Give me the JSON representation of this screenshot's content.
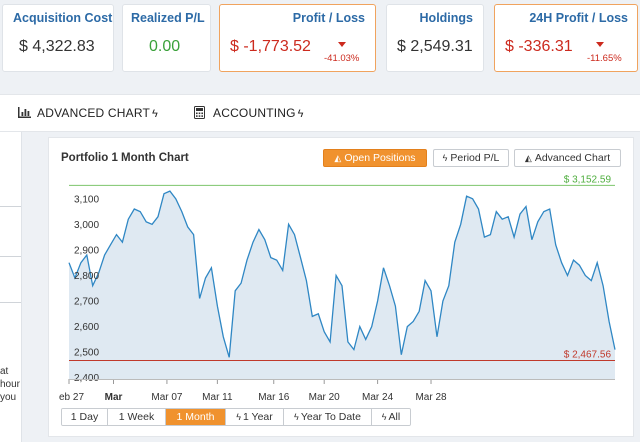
{
  "cards": [
    {
      "title": "Acquisition Cost",
      "value": "$ 4,322.83",
      "tone": "normal",
      "change": null
    },
    {
      "title": "Realized P/L",
      "value": "0.00",
      "tone": "green",
      "change": null
    },
    {
      "title": "Profit / Loss",
      "value": "$ -1,773.52",
      "tone": "red",
      "change": "-41.03%"
    },
    {
      "title": "Holdings",
      "value": "$ 2,549.31",
      "tone": "normal",
      "change": null
    },
    {
      "title": "24H Profit / Loss",
      "value": "$ -336.31",
      "tone": "red",
      "change": "-11.65%"
    }
  ],
  "toolbar": {
    "advanced_chart": "ADVANCED CHART",
    "accounting": "ACCOUNTING"
  },
  "sidebar": {
    "text_1": "at",
    "text_2": "hour",
    "text_3": "you"
  },
  "chart_panel": {
    "title": "Portfolio 1 Month Chart",
    "buttons": {
      "open_positions": "Open Positions",
      "period_pl": "Period P/L",
      "advanced_chart": "Advanced Chart"
    },
    "ranges": [
      "1 Day",
      "1 Week",
      "1 Month",
      "1 Year",
      "Year To Date",
      "All"
    ],
    "active_range": "1 Month"
  },
  "colors": {
    "accent_orange": "#f0922e",
    "title_blue": "#2c6aa6",
    "profit_green": "#3aa13a",
    "loss_red": "#cc2a1e",
    "line_blue": "#2f87c4",
    "area_fill": "#dfe9f2"
  },
  "chart_data": {
    "type": "area",
    "title": "Portfolio 1 Month Chart",
    "x_ticks": [
      "eb 27",
      "Mar",
      "Mar 07",
      "Mar 11",
      "Mar 16",
      "Mar 20",
      "Mar 24",
      "Mar 28"
    ],
    "x_tick_indices": [
      0,
      7.5,
      16.5,
      25,
      34.5,
      43,
      52,
      61
    ],
    "y_ticks": [
      2400,
      2500,
      2600,
      2700,
      2800,
      2900,
      3000,
      3100
    ],
    "ylim": [
      2395,
      3150
    ],
    "high_label": "$ 3,152.59",
    "high_value": 3152.59,
    "low_label": "$ 2,467.56",
    "low_value": 2467.56,
    "grid": false,
    "series": [
      {
        "values": [
          2850,
          2790,
          2850,
          2880,
          2760,
          2810,
          2880,
          2920,
          2960,
          2930,
          3020,
          3060,
          3050,
          3010,
          3000,
          3030,
          3120,
          3130,
          3100,
          3050,
          2990,
          2960,
          2710,
          2790,
          2830,
          2680,
          2560,
          2480,
          2740,
          2770,
          2860,
          2930,
          2980,
          2940,
          2870,
          2860,
          2820,
          3000,
          2960,
          2870,
          2780,
          2640,
          2650,
          2580,
          2540,
          2800,
          2760,
          2540,
          2510,
          2600,
          2550,
          2600,
          2700,
          2830,
          2760,
          2680,
          2490,
          2600,
          2620,
          2660,
          2780,
          2740,
          2560,
          2700,
          2760,
          2930,
          3000,
          3110,
          3100,
          3060,
          2950,
          2960,
          3050,
          3020,
          3030,
          2950,
          3040,
          3070,
          2940,
          3010,
          3050,
          3060,
          2920,
          2850,
          2800,
          2860,
          2840,
          2800,
          2780,
          2850,
          2760,
          2620,
          2510
        ]
      }
    ]
  }
}
